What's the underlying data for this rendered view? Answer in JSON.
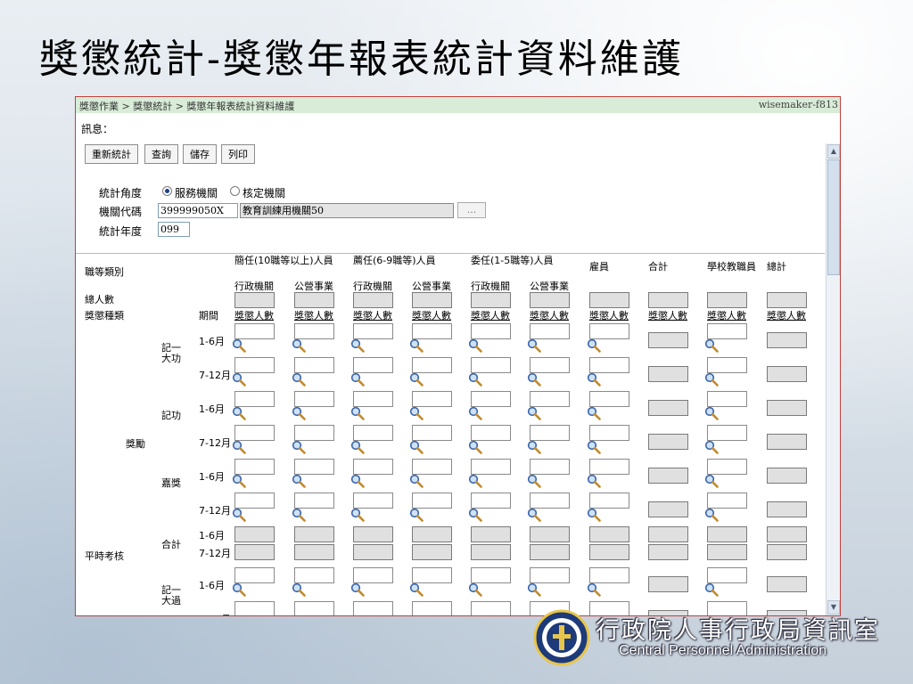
{
  "slide": {
    "title": "獎懲統計-獎懲年報表統計資料維護"
  },
  "breadcrumb": {
    "text": "獎懲作業 > 獎懲統計 > 獎懲年報表統計資料維護",
    "user": "wisemaker-f813"
  },
  "message_label": "訊息：",
  "toolbar": {
    "recalc": "重新統計",
    "query": "查詢",
    "save": "儲存",
    "print": "列印"
  },
  "form": {
    "angle_label": "統計角度",
    "angle_options": [
      "服務機關",
      "核定機關"
    ],
    "angle_selected": "服務機關",
    "org_code_label": "機關代碼",
    "org_code_value": "399999050X",
    "org_name_value": "教育訓練用機關50",
    "lookup_button": "...",
    "year_label": "統計年度",
    "year_value": "099"
  },
  "table": {
    "corner_label": "職等類別",
    "total_count_label": "總人數",
    "type_label": "獎懲種類",
    "period_label": "期間",
    "count_label": "獎懲人數",
    "groups": [
      {
        "label": "簡任(10職等以上)人員",
        "subs": [
          "行政機關",
          "公營事業"
        ]
      },
      {
        "label": "薦任(6-9職等)人員",
        "subs": [
          "行政機關",
          "公營事業"
        ]
      },
      {
        "label": "委任(1-5職等)人員",
        "subs": [
          "行政機關",
          "公營事業"
        ]
      }
    ],
    "single_cols": [
      "雇員",
      "合計",
      "學校教職員",
      "總計"
    ],
    "category_reward": "獎勵",
    "category_regular": "平時考核",
    "items": [
      "記一大功",
      "記功",
      "嘉獎",
      "合計",
      "記一大過"
    ],
    "periods": [
      "1-6月",
      "7-12月"
    ]
  },
  "footer": {
    "org_cn": "行政院人事行政局資訊室",
    "org_en": "Central Personnel Administration"
  }
}
